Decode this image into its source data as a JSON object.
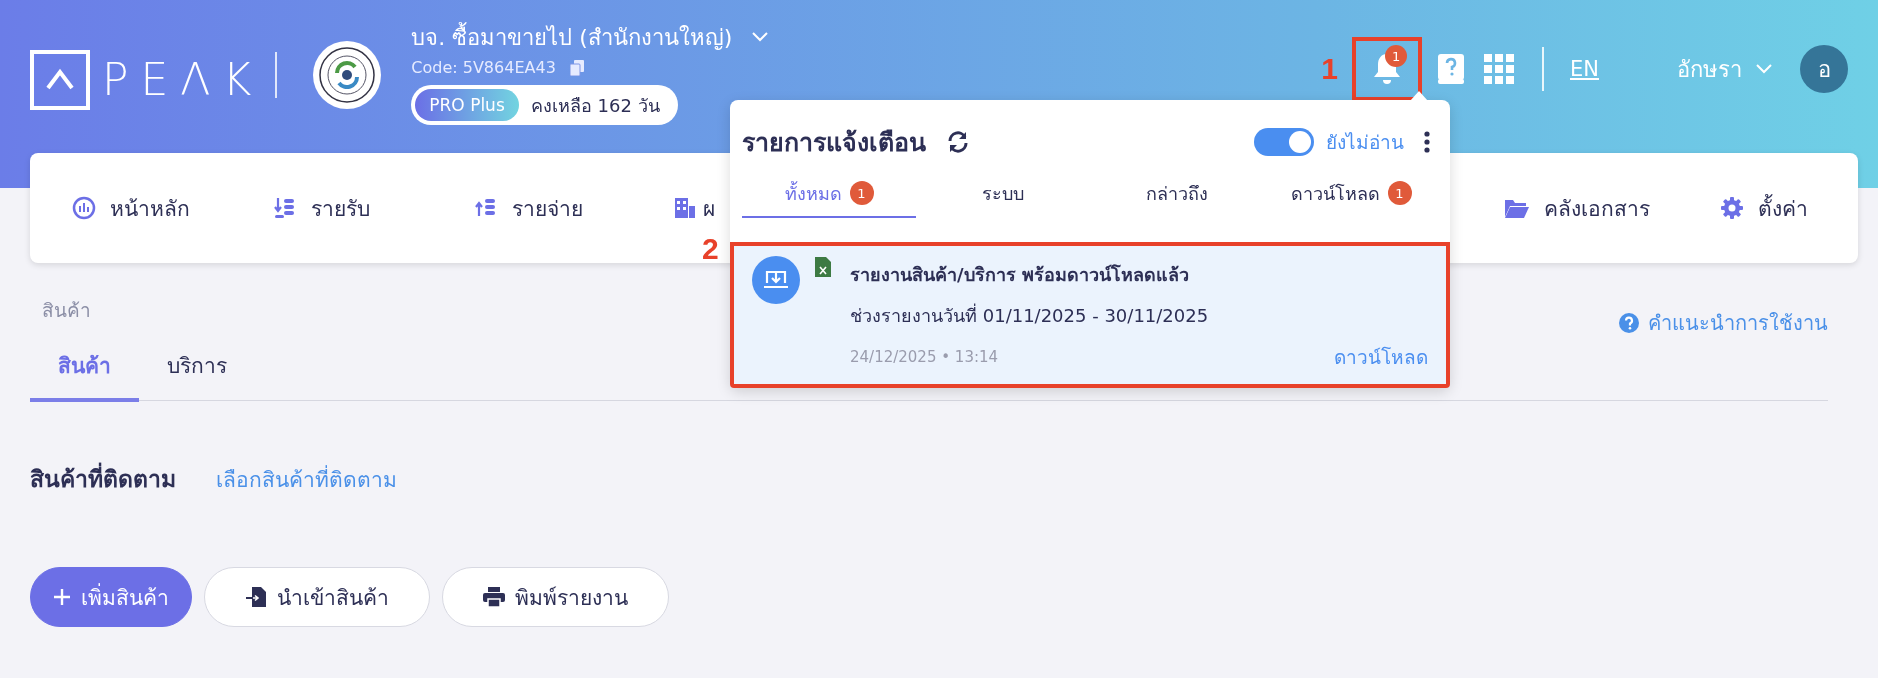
{
  "header": {
    "logo": "PEΛK",
    "company": {
      "name": "บจ. ซื้อมาขายไป (สำนักงานใหญ่)",
      "code": "Code: 5V864EA43",
      "plan": "PRO Plus",
      "remaining": "คงเหลือ 162 วัน"
    },
    "bell_badge": "1",
    "language": "EN",
    "user": {
      "name": "อักษรา",
      "initial": "อ"
    }
  },
  "nav": [
    {
      "label": "หน้าหลัก",
      "kind": "gauge"
    },
    {
      "label": "รายรับ",
      "kind": "income"
    },
    {
      "label": "รายจ่าย",
      "kind": "expense"
    },
    {
      "label": "ผ",
      "kind": "building"
    },
    {
      "label": "คลังเอกสาร",
      "kind": "folder"
    },
    {
      "label": "ตั้งค่า",
      "kind": "gear"
    }
  ],
  "annotations": [
    "1",
    "2"
  ],
  "notifications": {
    "title": "รายการแจ้งเตือน",
    "unread_toggle": {
      "on": true,
      "label": "ยังไม่อ่าน"
    },
    "tabs": [
      {
        "label": "ทั้งหมด",
        "badge": "1",
        "selected": true
      },
      {
        "label": "ระบบ",
        "selected": false
      },
      {
        "label": "กล่าวถึง",
        "selected": false
      },
      {
        "label": "ดาวน์โหลด",
        "badge": "1",
        "selected": false
      }
    ],
    "items": [
      {
        "title": "รายงานสินค้า/บริการ พร้อมดาวน์โหลดแล้ว",
        "detail": "ช่วงรายงานวันที่ 01/11/2025 - 30/11/2025",
        "time": "24/12/2025 • 13:14",
        "action": "ดาวน์โหลด",
        "unread": true
      }
    ]
  },
  "page": {
    "breadcrumb": "สินค้า",
    "help": "คำแนะนำการใช้งาน",
    "tabs": [
      {
        "label": "สินค้า",
        "selected": true
      },
      {
        "label": "บริการ",
        "selected": false
      }
    ],
    "section_title": "สินค้าที่ติดตาม",
    "section_link": "เลือกสินค้าที่ติดตาม",
    "buttons": [
      {
        "label": "เพิ่มสินค้า",
        "kind": "add"
      },
      {
        "label": "นำเข้าสินค้า",
        "kind": "import"
      },
      {
        "label": "พิมพ์รายงาน",
        "kind": "print"
      }
    ]
  }
}
